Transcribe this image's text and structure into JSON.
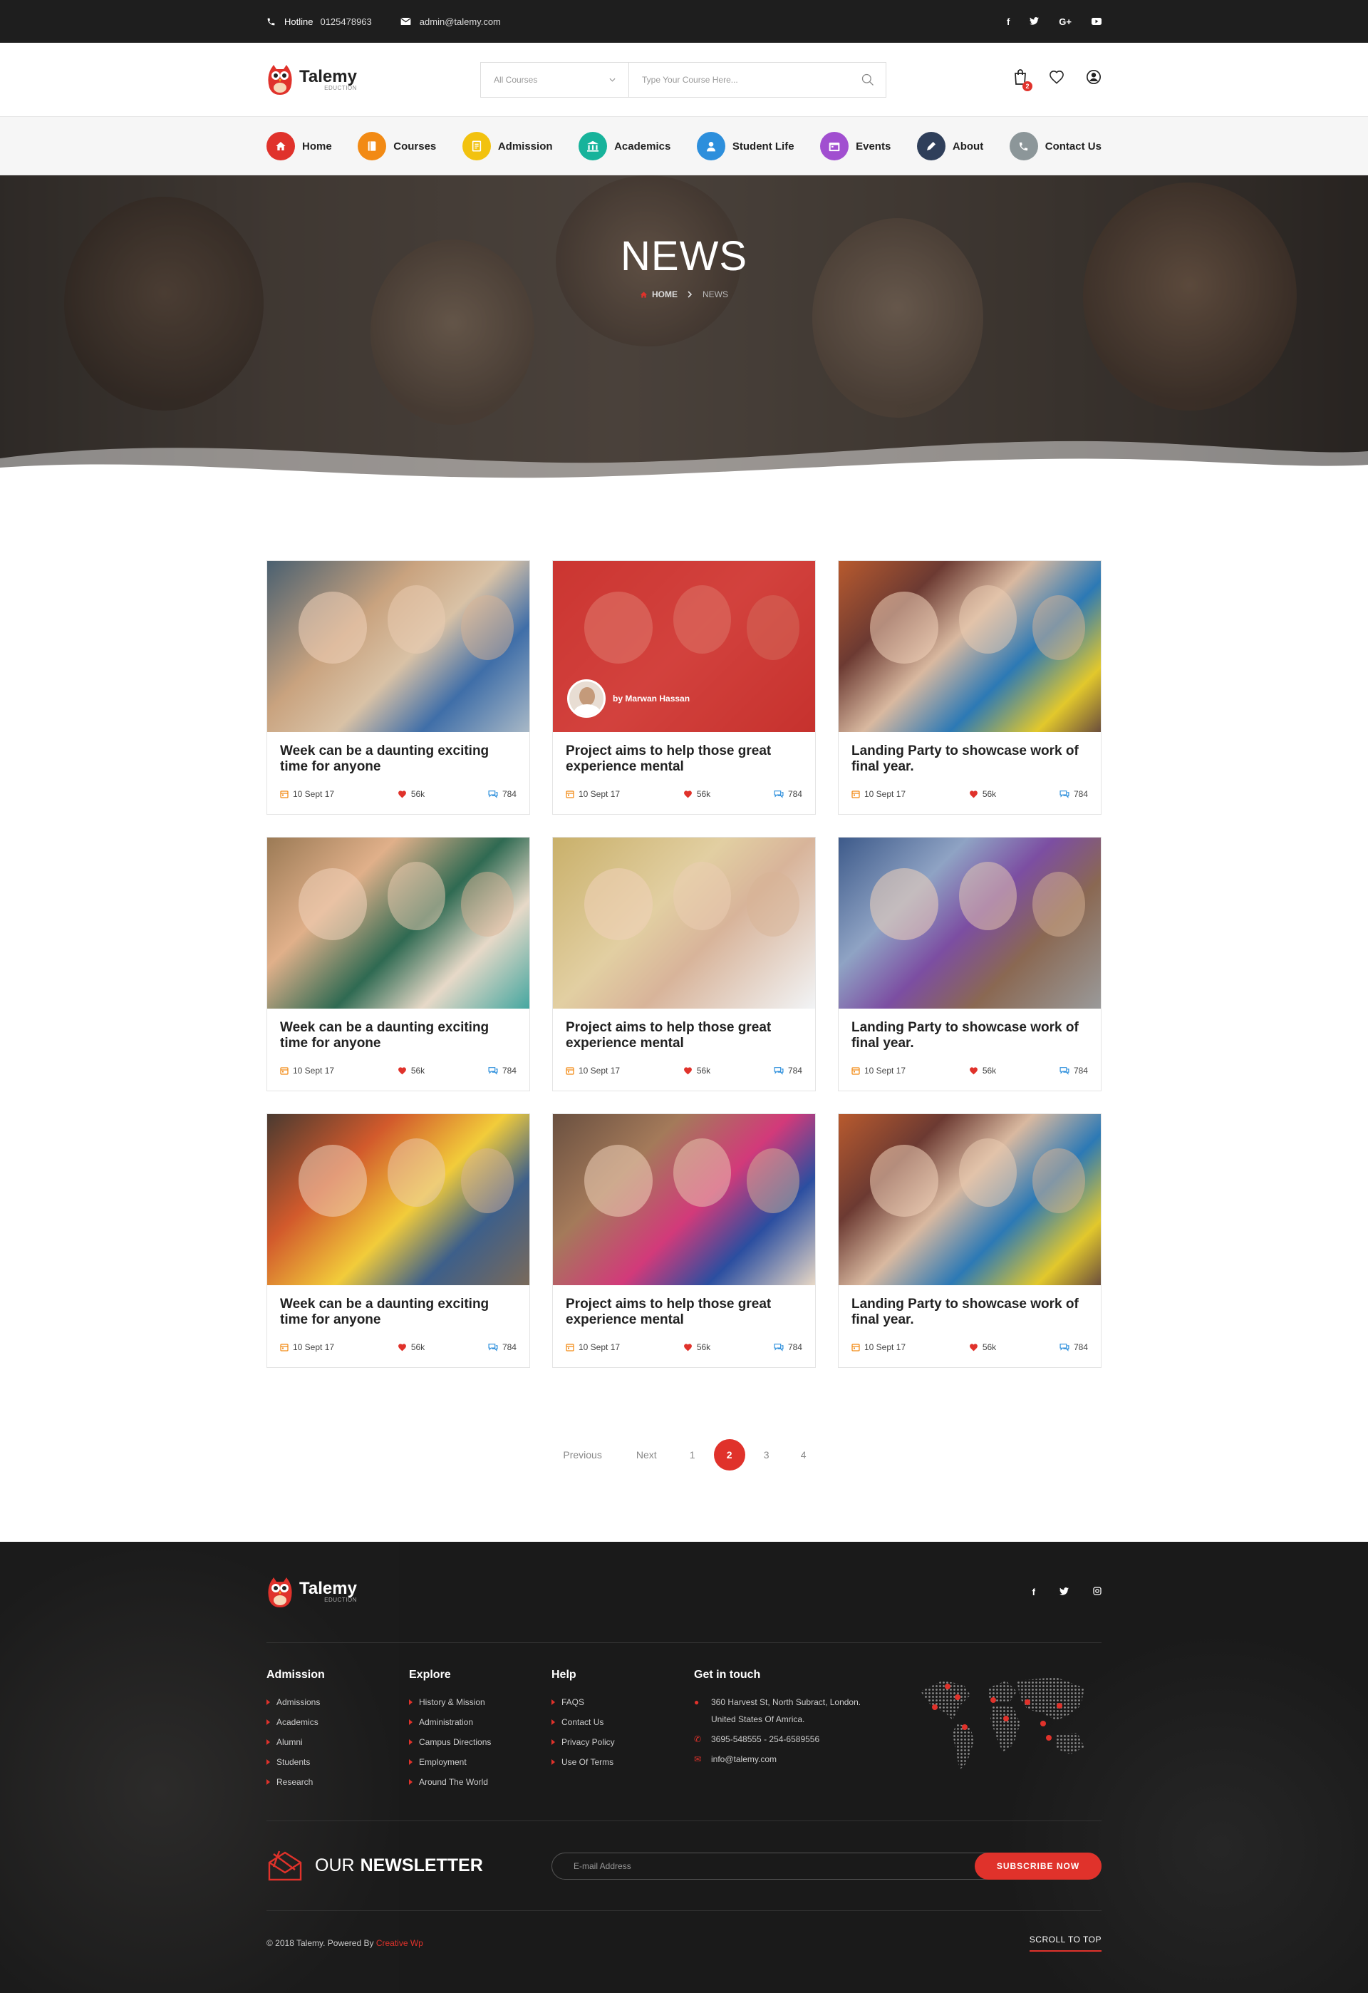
{
  "topbar": {
    "hotline_label": "Hotline",
    "hotline_number": "0125478963",
    "email": "admin@talemy.com",
    "social": [
      "f",
      "t",
      "G+",
      "yt"
    ]
  },
  "brand": {
    "name": "Talemy",
    "tagline": "EDUCTION"
  },
  "search": {
    "category": "All Courses",
    "placeholder": "Type Your Course Here..."
  },
  "cart": {
    "count": "2"
  },
  "nav": [
    {
      "label": "Home",
      "color": "#e0322b",
      "icon": "home-icon"
    },
    {
      "label": "Courses",
      "color": "#f28a14",
      "icon": "book-icon"
    },
    {
      "label": "Admission",
      "color": "#f2c20f",
      "icon": "document-icon"
    },
    {
      "label": "Academics",
      "color": "#17b39b",
      "icon": "bank-icon"
    },
    {
      "label": "Student Life",
      "color": "#2d8fdc",
      "icon": "user-icon"
    },
    {
      "label": "Events",
      "color": "#a14fd0",
      "icon": "calendar-icon"
    },
    {
      "label": "About",
      "color": "#2f3f5a",
      "icon": "pen-icon"
    },
    {
      "label": "Contact Us",
      "color": "#8c9699",
      "icon": "phone-icon"
    }
  ],
  "hero": {
    "title": "NEWS",
    "crumb_home": "HOME",
    "crumb_current": "NEWS"
  },
  "posts": [
    {
      "title": "Week can be a daunting exciting time for anyone",
      "date": "10 Sept 17",
      "likes": "56k",
      "comments": "784"
    },
    {
      "title": "Project aims to help those great experience mental",
      "date": "10 Sept 17",
      "likes": "56k",
      "comments": "784",
      "author": "by Marwan Hassan"
    },
    {
      "title": "Landing Party to showcase work of final year.",
      "date": "10 Sept 17",
      "likes": "56k",
      "comments": "784"
    },
    {
      "title": "Week can be a daunting exciting time for anyone",
      "date": "10 Sept 17",
      "likes": "56k",
      "comments": "784"
    },
    {
      "title": "Project aims to help those great experience mental",
      "date": "10 Sept 17",
      "likes": "56k",
      "comments": "784"
    },
    {
      "title": "Landing Party to showcase work of final year.",
      "date": "10 Sept 17",
      "likes": "56k",
      "comments": "784"
    },
    {
      "title": "Week can be a daunting exciting time for anyone",
      "date": "10 Sept 17",
      "likes": "56k",
      "comments": "784"
    },
    {
      "title": "Project aims to help those great experience mental",
      "date": "10 Sept 17",
      "likes": "56k",
      "comments": "784"
    },
    {
      "title": "Landing Party to showcase work of final year.",
      "date": "10 Sept 17",
      "likes": "56k",
      "comments": "784"
    }
  ],
  "pagination": {
    "previous": "Previous",
    "next": "Next",
    "pages": [
      "1",
      "2",
      "3",
      "4"
    ],
    "current": "2"
  },
  "footer": {
    "social": [
      "f",
      "t",
      "ig"
    ],
    "columns": [
      {
        "title": "Admission",
        "items": [
          "Admissions",
          "Academics",
          "Alumni",
          "Students",
          "Research"
        ]
      },
      {
        "title": "Explore",
        "items": [
          "History & Mission",
          "Administration",
          "Campus Directions",
          "Employment",
          "Around The World"
        ]
      },
      {
        "title": "Help",
        "items": [
          "FAQS",
          "Contact Us",
          "Privacy Policy",
          "Use Of Terms"
        ]
      }
    ],
    "contact": {
      "title": "Get in touch",
      "address_line1": "360 Harvest St, North Subract, London.",
      "address_line2": "United States Of Amrica.",
      "phones": "3695-548555   -   254-6589556",
      "email": "info@talemy.com"
    },
    "newsletter": {
      "title_a": "OUR",
      "title_b": "NEWSLETTER",
      "placeholder": "E-mail Address",
      "button": "SUBSCRIBE NOW"
    },
    "copyright": "© 2018 Talemy.  Powered By",
    "powered": "Creative Wp",
    "scroll_top": "SCROLL TO TOP"
  },
  "colors": {
    "accent": "#e0322b",
    "dark": "#1e1e1e"
  }
}
